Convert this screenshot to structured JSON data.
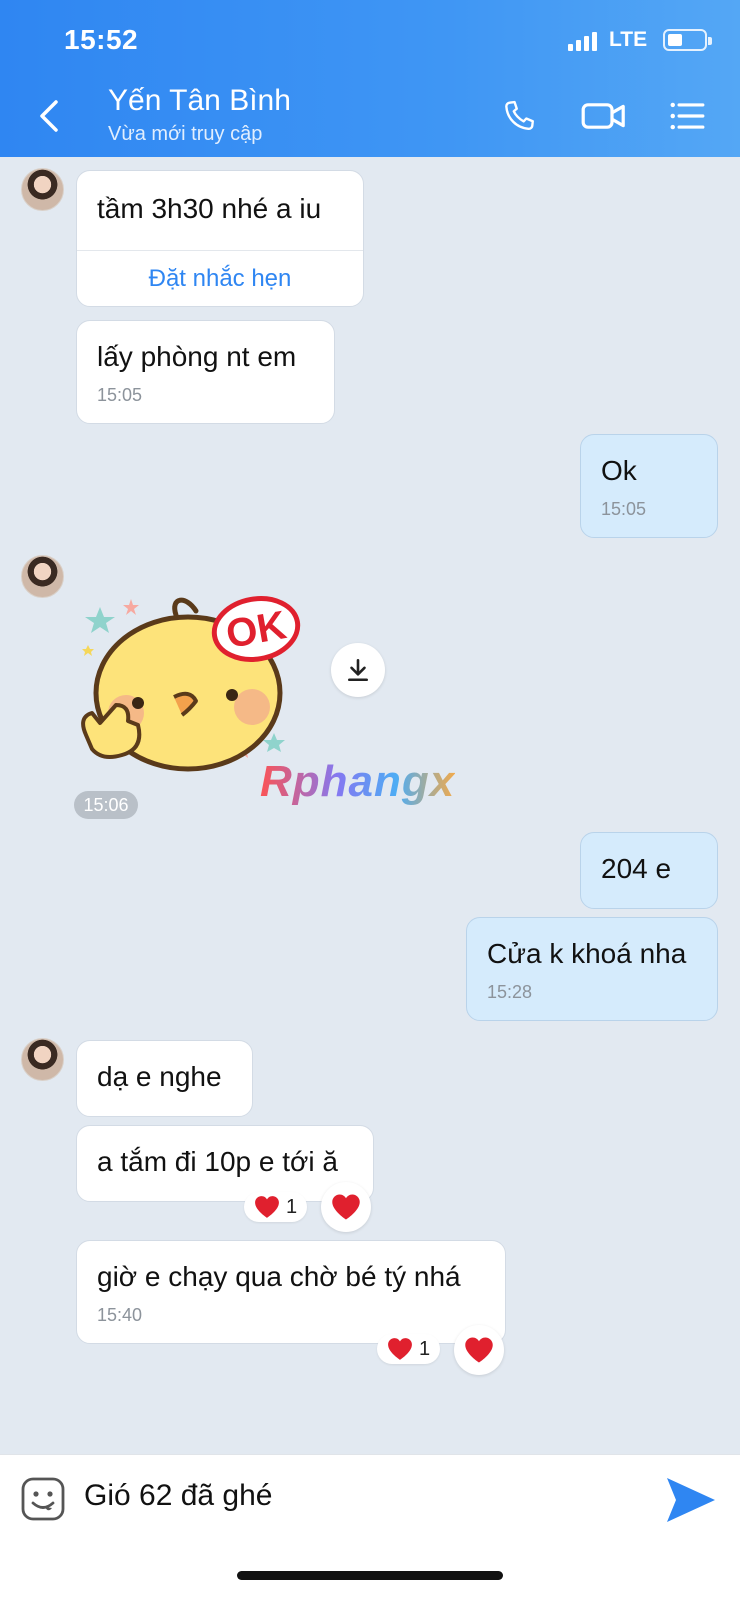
{
  "status_bar": {
    "time": "15:52",
    "network": "LTE"
  },
  "header": {
    "name": "Yến Tân Bình",
    "status": "Vừa mới truy cập"
  },
  "messages": [
    {
      "text": "tầm 3h30 nhé a iu",
      "action": "Đặt nhắc hẹn"
    },
    {
      "text": "lấy phòng nt em",
      "time": "15:05"
    },
    {
      "text": "Ok",
      "time": "15:05"
    },
    {
      "sticker_text": "OK",
      "time": "15:06",
      "watermark": "Rphangx"
    },
    {
      "text": "204 e"
    },
    {
      "text": "Cửa k khoá nha",
      "time": "15:28"
    },
    {
      "text": "dạ e nghe"
    },
    {
      "text": "a tắm đi 10p e tới ă",
      "reaction_count": "1"
    },
    {
      "text": "giờ e chạy qua chờ bé tý nhá",
      "time": "15:40",
      "reaction_count": "1"
    }
  ],
  "input": {
    "value": "Gió 62 đã ghé"
  },
  "colors": {
    "header": "#3f96f4",
    "accent": "#2f86f2",
    "incoming": "#ffffff",
    "outgoing": "#d5ebfc",
    "heart": "#e0202e"
  },
  "icons": [
    "back-icon",
    "phone-icon",
    "video-call-icon",
    "menu-icon",
    "download-icon",
    "heart-icon",
    "emoji-icon",
    "send-icon"
  ]
}
